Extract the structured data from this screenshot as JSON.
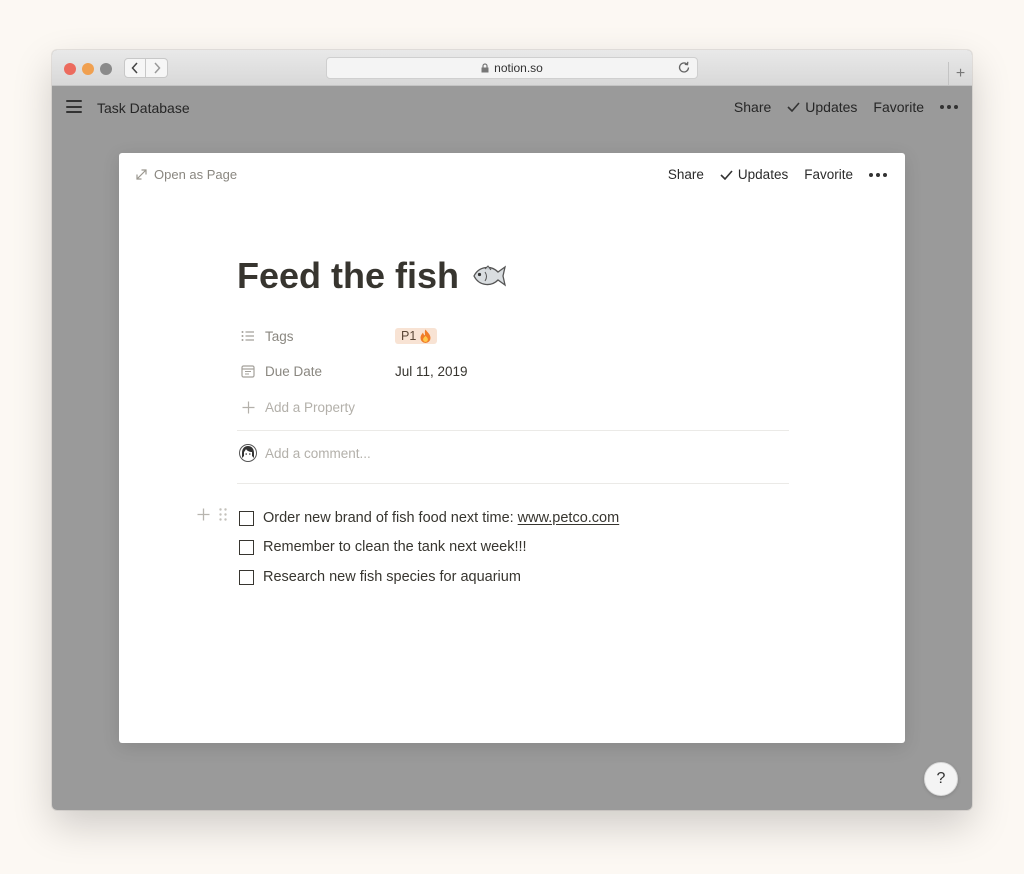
{
  "browser": {
    "url": "notion.so",
    "new_tab": "+",
    "traffic_lights": [
      "#ec6b5e",
      "#f0a050",
      "#8a8a8a"
    ]
  },
  "topbar": {
    "title": "Task Database",
    "share_label": "Share",
    "updates_label": "Updates",
    "favorite_label": "Favorite"
  },
  "modal": {
    "open_as_page_label": "Open as Page",
    "share_label": "Share",
    "updates_label": "Updates",
    "favorite_label": "Favorite",
    "title": "Feed the fish",
    "title_icon": "fish-icon",
    "properties": [
      {
        "name": "Tags",
        "icon": "list-icon",
        "value": "P1",
        "value_icon": "fire-icon"
      },
      {
        "name": "Due Date",
        "icon": "calendar-icon",
        "value": "Jul 11, 2019"
      }
    ],
    "add_property_label": "Add a Property",
    "comment_placeholder": "Add a comment...",
    "todos": [
      {
        "text": "Order new brand of fish food next time:",
        "link": "www.petco.com",
        "checked": false
      },
      {
        "text": "Remember to clean the tank next week!!!",
        "checked": false
      },
      {
        "text": "Research new fish species for aquarium",
        "checked": false
      }
    ]
  },
  "help_label": "?",
  "colors": {
    "desktop_bg": "#fcf8f3",
    "overlay_bg": "#9a9a9a",
    "tag_bg": "#f8e3d4",
    "text": "#37352f",
    "muted_text": "#8a8780"
  }
}
